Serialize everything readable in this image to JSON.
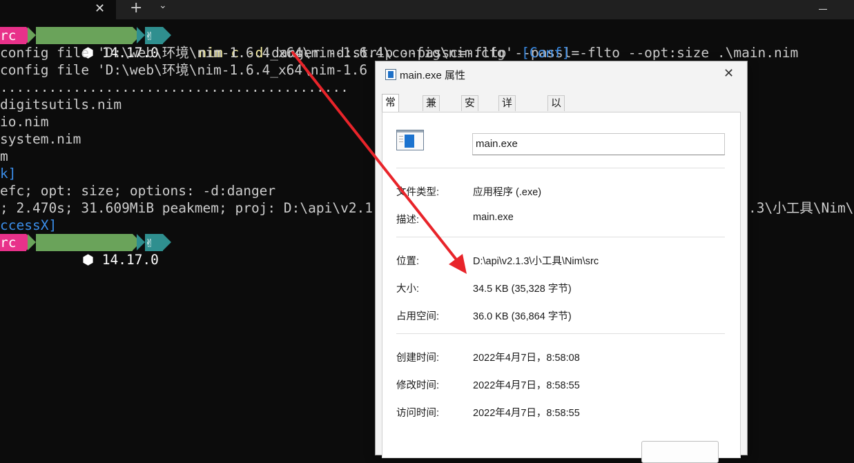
{
  "tabbar": {
    "close_glyph": "✕",
    "new_tab_glyph": "+",
    "dropdown_glyph": "⌄"
  },
  "terminal": {
    "prompt": {
      "dir": "rc",
      "node_version": "⬢ 14.17.0",
      "git_icon": "✌"
    },
    "command": {
      "main": "nim c -d",
      "rest": ":danger -d:strip --passc=-flto --passl=-flto --opt:size .\\main.nim"
    },
    "lines": [
      {
        "text": "config file 'D:\\web\\环境\\nim-1.6.4_x64\\nim-1.6.4\\config\\nim.cfg' ",
        "tag": "[Conf]"
      },
      {
        "text": "config file 'D:\\web\\环境\\nim-1.6.4_x64\\nim-1.6",
        "tag": ""
      },
      {
        "text": "...........................................",
        "tag": ""
      },
      {
        "text": "digitsutils.nim",
        "tag": ""
      },
      {
        "text": "io.nim",
        "tag": ""
      },
      {
        "text": "system.nim",
        "tag": ""
      },
      {
        "text": "m",
        "tag": ""
      },
      {
        "text": "",
        "tag": "k]"
      },
      {
        "text": "efc; opt: size; options: -d:danger",
        "tag": ""
      },
      {
        "text": "; 2.470s; 31.609MiB peakmem; proj: D:\\api\\v2.1",
        "tag": ""
      },
      {
        "text": "",
        "tag": "ccessX]"
      }
    ],
    "line_tail": ".3\\小工具\\Nim\\"
  },
  "dialog": {
    "title": "main.exe 属性",
    "close_glyph": "✕",
    "tabs": [
      "常规",
      "兼容性",
      "安全",
      "详细信息",
      "以前的版本"
    ],
    "filename": "main.exe",
    "fields": [
      {
        "label": "文件类型:",
        "value": "应用程序 (.exe)"
      },
      {
        "label": "描述:",
        "value": "main.exe"
      },
      {
        "label": "位置:",
        "value": "D:\\api\\v2.1.3\\小工具\\Nim\\src"
      },
      {
        "label": "大小:",
        "value": "34.5 KB (35,328 字节)"
      },
      {
        "label": "占用空间:",
        "value": "36.0 KB (36,864 字节)"
      },
      {
        "label": "创建时间:",
        "value": "2022年4月7日，8:58:08"
      },
      {
        "label": "修改时间:",
        "value": "2022年4月7日，8:58:55"
      },
      {
        "label": "访问时间:",
        "value": "2022年4月7日，8:58:55"
      }
    ]
  },
  "colors": {
    "terminal_bg": "#0c0c0c",
    "prompt_pink": "#e8318a",
    "prompt_green": "#6aa35a",
    "prompt_teal": "#2f8f8f",
    "annotation_red": "#e8242a",
    "link_blue": "#3b8eea"
  }
}
